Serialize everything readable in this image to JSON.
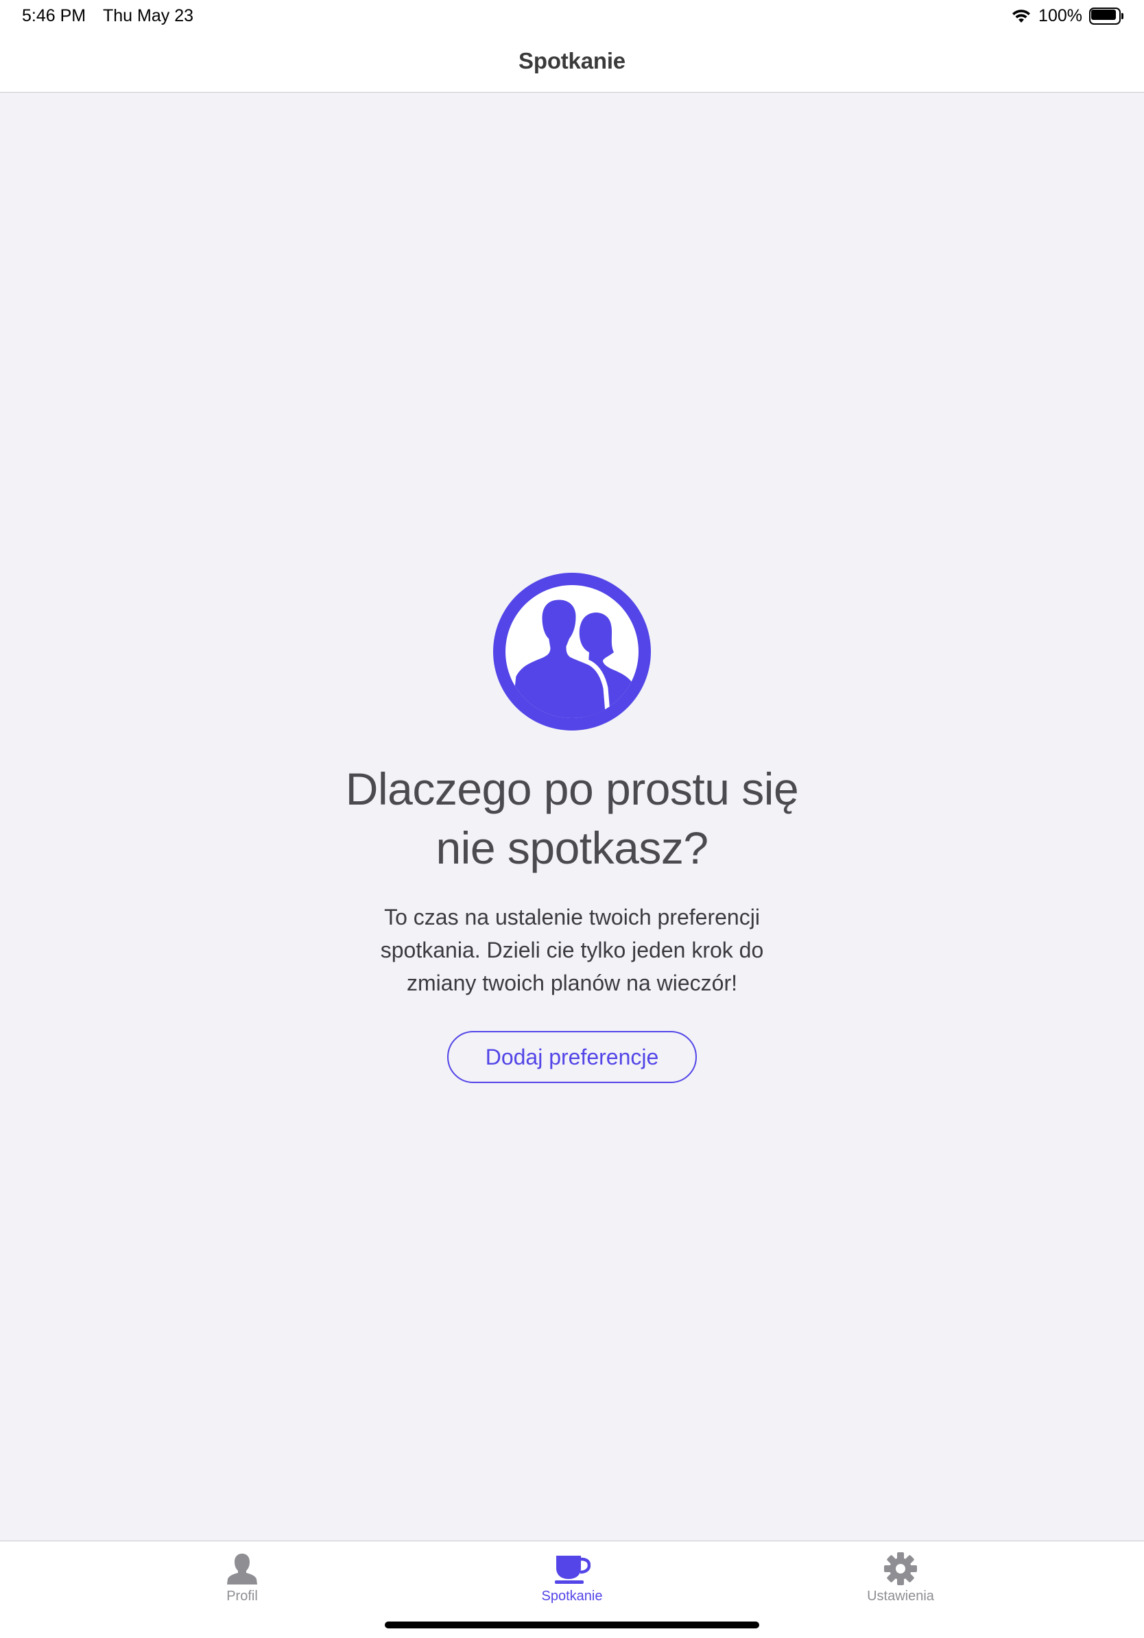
{
  "status_bar": {
    "time": "5:46 PM",
    "date": "Thu May 23",
    "battery_percent": "100%",
    "battery_level": 1.0,
    "icons": [
      "wifi-icon",
      "battery-icon"
    ]
  },
  "nav": {
    "title": "Spotkanie"
  },
  "empty_state": {
    "icon": "people-icon",
    "headline": "Dlaczego po prostu się nie spotkasz?",
    "description": "To czas na ustalenie twoich preferencji spotkania. Dzieli cie tylko jeden krok do zmiany twoich planów na wieczór!",
    "button_label": "Dodaj preferencje"
  },
  "tab_bar": {
    "tabs": [
      {
        "label": "Profil",
        "icon": "person-icon",
        "active": false
      },
      {
        "label": "Spotkanie",
        "icon": "coffee-cup-icon",
        "active": true
      },
      {
        "label": "Ustawienia",
        "icon": "gear-icon",
        "active": false
      }
    ]
  },
  "colors": {
    "accent": "#5345e7",
    "background": "#f2f2f7",
    "inactive_tab": "#8e8e93"
  }
}
